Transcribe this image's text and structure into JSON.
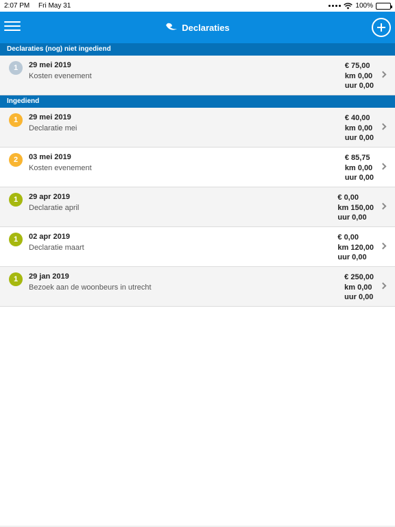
{
  "status_bar": {
    "time": "2:07 PM",
    "date": "Fri May 31",
    "battery": "100%",
    "battery_level": 1.0,
    "icons": [
      "signal-dots-icon",
      "wifi-icon",
      "battery-icon"
    ]
  },
  "navbar": {
    "title": "Declaraties",
    "left_icon": "hamburger-menu-icon",
    "right_icon": "add-circle-icon",
    "logo_icon": "app-logo-icon",
    "background": "#0a8be0"
  },
  "colors": {
    "section_header": "#0671b8",
    "badge_grey": "#b8c8d6",
    "badge_orange": "#f9b531",
    "badge_green": "#a6b80f"
  },
  "sections": [
    {
      "title": "Declaraties (nog) niet ingediend",
      "items": [
        {
          "badge": "1",
          "badge_color": "#b8c8d6",
          "date": "29 mei 2019",
          "description": "Kosten evenement",
          "amount": "€ 75,00",
          "km": "km 0,00",
          "uur": "uur 0,00"
        }
      ]
    },
    {
      "title": "Ingediend",
      "items": [
        {
          "badge": "1",
          "badge_color": "#f9b531",
          "date": "29 mei 2019",
          "description": "Declaratie mei",
          "amount": "€ 40,00",
          "km": "km 0,00",
          "uur": "uur 0,00"
        },
        {
          "badge": "2",
          "badge_color": "#f9b531",
          "date": "03 mei 2019",
          "description": "Kosten evenement",
          "amount": "€ 85,75",
          "km": "km 0,00",
          "uur": "uur 0,00"
        },
        {
          "badge": "1",
          "badge_color": "#a6b80f",
          "date": "29 apr 2019",
          "description": "Declaratie april",
          "amount": "€ 0,00",
          "km": "km 150,00",
          "uur": "uur 0,00"
        },
        {
          "badge": "1",
          "badge_color": "#a6b80f",
          "date": "02 apr 2019",
          "description": "Declaratie maart",
          "amount": "€ 0,00",
          "km": "km 120,00",
          "uur": "uur 0,00"
        },
        {
          "badge": "1",
          "badge_color": "#a6b80f",
          "date": "29 jan 2019",
          "description": "Bezoek aan de woonbeurs in utrecht",
          "amount": "€ 250,00",
          "km": "km 0,00",
          "uur": "uur 0,00"
        }
      ]
    }
  ]
}
